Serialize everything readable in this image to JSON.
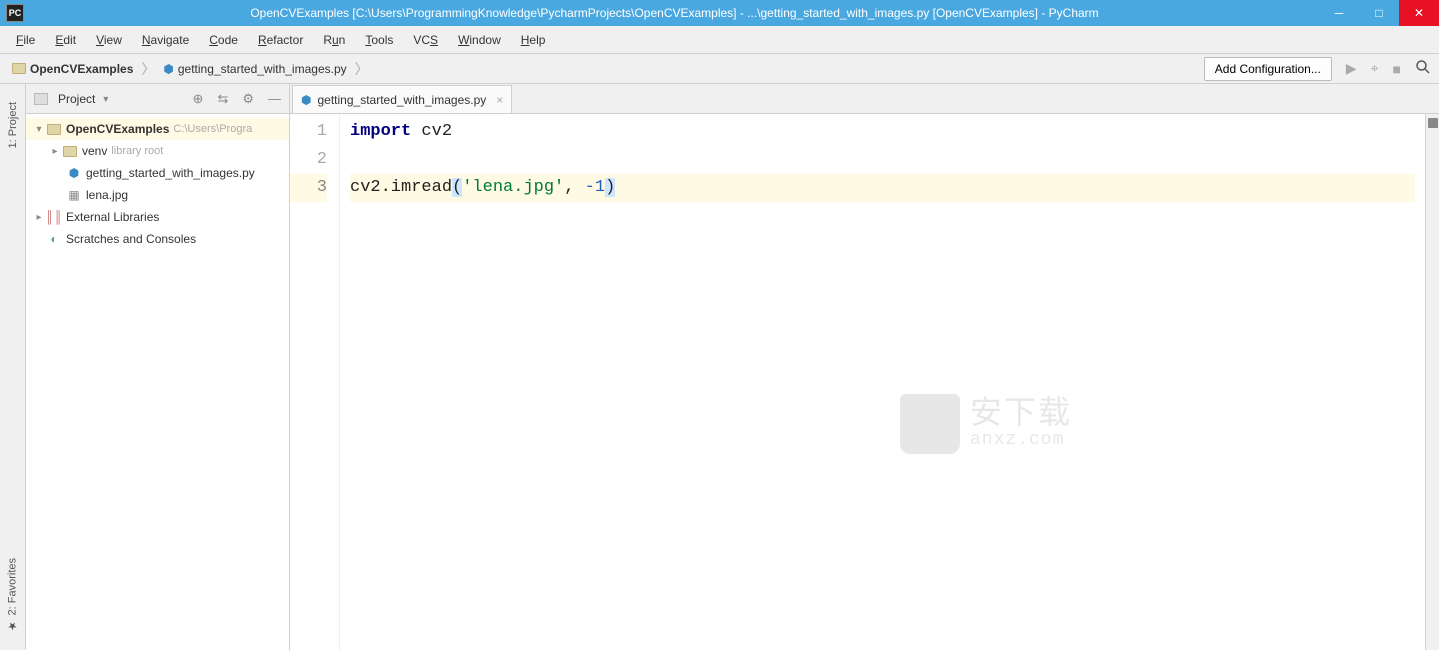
{
  "title_bar": {
    "app_icon_text": "PC",
    "title": "OpenCVExamples [C:\\Users\\ProgrammingKnowledge\\PycharmProjects\\OpenCVExamples] - ...\\getting_started_with_images.py [OpenCVExamples] - PyCharm"
  },
  "menu": {
    "file": "File",
    "edit": "Edit",
    "view": "View",
    "navigate": "Navigate",
    "code": "Code",
    "refactor": "Refactor",
    "run": "Run",
    "tools": "Tools",
    "vcs": "VCS",
    "window": "Window",
    "help": "Help"
  },
  "breadcrumb": {
    "project": "OpenCVExamples",
    "file": "getting_started_with_images.py"
  },
  "nav": {
    "add_config": "Add Configuration..."
  },
  "sidebar": {
    "project_tab": "1: Project",
    "favorites_tab": "2: Favorites"
  },
  "project_panel": {
    "title": "Project"
  },
  "tree": {
    "root": "OpenCVExamples",
    "root_hint": "C:\\Users\\Progra",
    "venv": "venv",
    "venv_hint": "library root",
    "file1": "getting_started_with_images.py",
    "file2": "lena.jpg",
    "ext_lib": "External Libraries",
    "scratches": "Scratches and Consoles"
  },
  "tab": {
    "file": "getting_started_with_images.py"
  },
  "gutter": {
    "line1": "1",
    "line2": "2",
    "line3": "3"
  },
  "code": {
    "line1_kw": "import",
    "line1_rest": " cv2",
    "line3_pre": "cv2.imread",
    "line3_lparen": "(",
    "line3_str": "'lena.jpg'",
    "line3_comma": ", ",
    "line3_num": "-1",
    "line3_rparen": ")"
  },
  "watermark": {
    "cn": "安下载",
    "en": "anxz.com"
  }
}
